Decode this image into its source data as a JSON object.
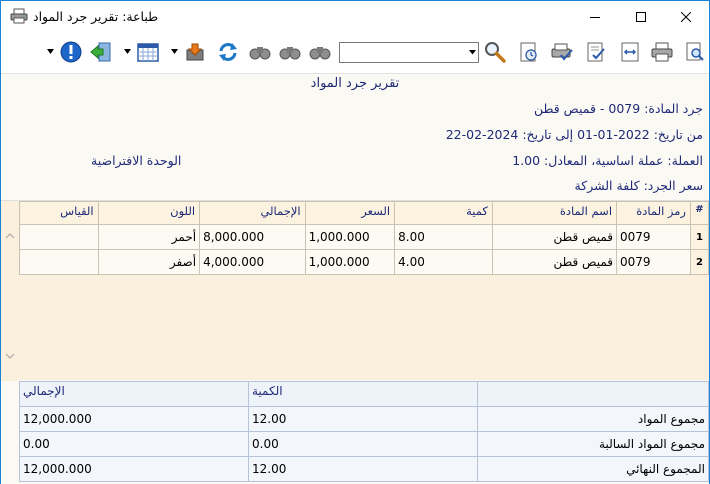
{
  "window": {
    "title": "طباعة: تقرير جرد المواد",
    "icons": [
      "printer-icon",
      "minimize-icon",
      "maximize-icon",
      "close-icon"
    ]
  },
  "toolbar": {
    "search_value": "",
    "icons": [
      "search-icon",
      "print-preview-icon",
      "print-icon",
      "fit-width-icon",
      "export-icon",
      "print-setup-icon",
      "print-check-icon",
      "binoculars-icon",
      "binoculars-prev-icon",
      "binoculars-next-icon",
      "refresh-icon",
      "export-file-icon",
      "calendar-icon",
      "exit-icon",
      "info-icon"
    ]
  },
  "report": {
    "title": "تقرير جرد المواد",
    "material_line": "جرد المادة: 0079 - قميص قطن",
    "date_line": "من تاريخ: 2022-01-01 إلى تاريخ: 2024-02-22",
    "currency_line": "العملة: عملة اساسية، المعادل: 1.00",
    "unit_line": "الوحدة الافتراضية",
    "price_line": "سعر الجرد: كلفة الشركة"
  },
  "grid": {
    "columns": [
      "#",
      "رمز المادة",
      "اسم المادة",
      "كمية",
      "السعر",
      "الإجمالي",
      "اللون",
      "القياس"
    ],
    "rows": [
      {
        "num": "1",
        "code": "0079",
        "name": "قميص قطن",
        "qty": "8.00",
        "price": "1,000.000",
        "total": "8,000.000",
        "color": "أحمر",
        "size": ""
      },
      {
        "num": "2",
        "code": "0079",
        "name": "قميص قطن",
        "qty": "4.00",
        "price": "1,000.000",
        "total": "4,000.000",
        "color": "أصفر",
        "size": ""
      }
    ]
  },
  "summary": {
    "headers": [
      "",
      "الكمية",
      "الإجمالي"
    ],
    "rows": [
      {
        "label": "مجموع المواد",
        "qty": "12.00",
        "total": "12,000.000"
      },
      {
        "label": "مجموع المواد السالبة",
        "qty": "0.00",
        "total": "0.00"
      },
      {
        "label": "المجموع النهائي",
        "qty": "12.00",
        "total": "12,000.000"
      }
    ]
  },
  "colors": {
    "accent": "#1e2a78",
    "window_border": "#1883d7",
    "grid_bg": "#fbf0dd",
    "summary_bg": "#f3f6fb"
  }
}
